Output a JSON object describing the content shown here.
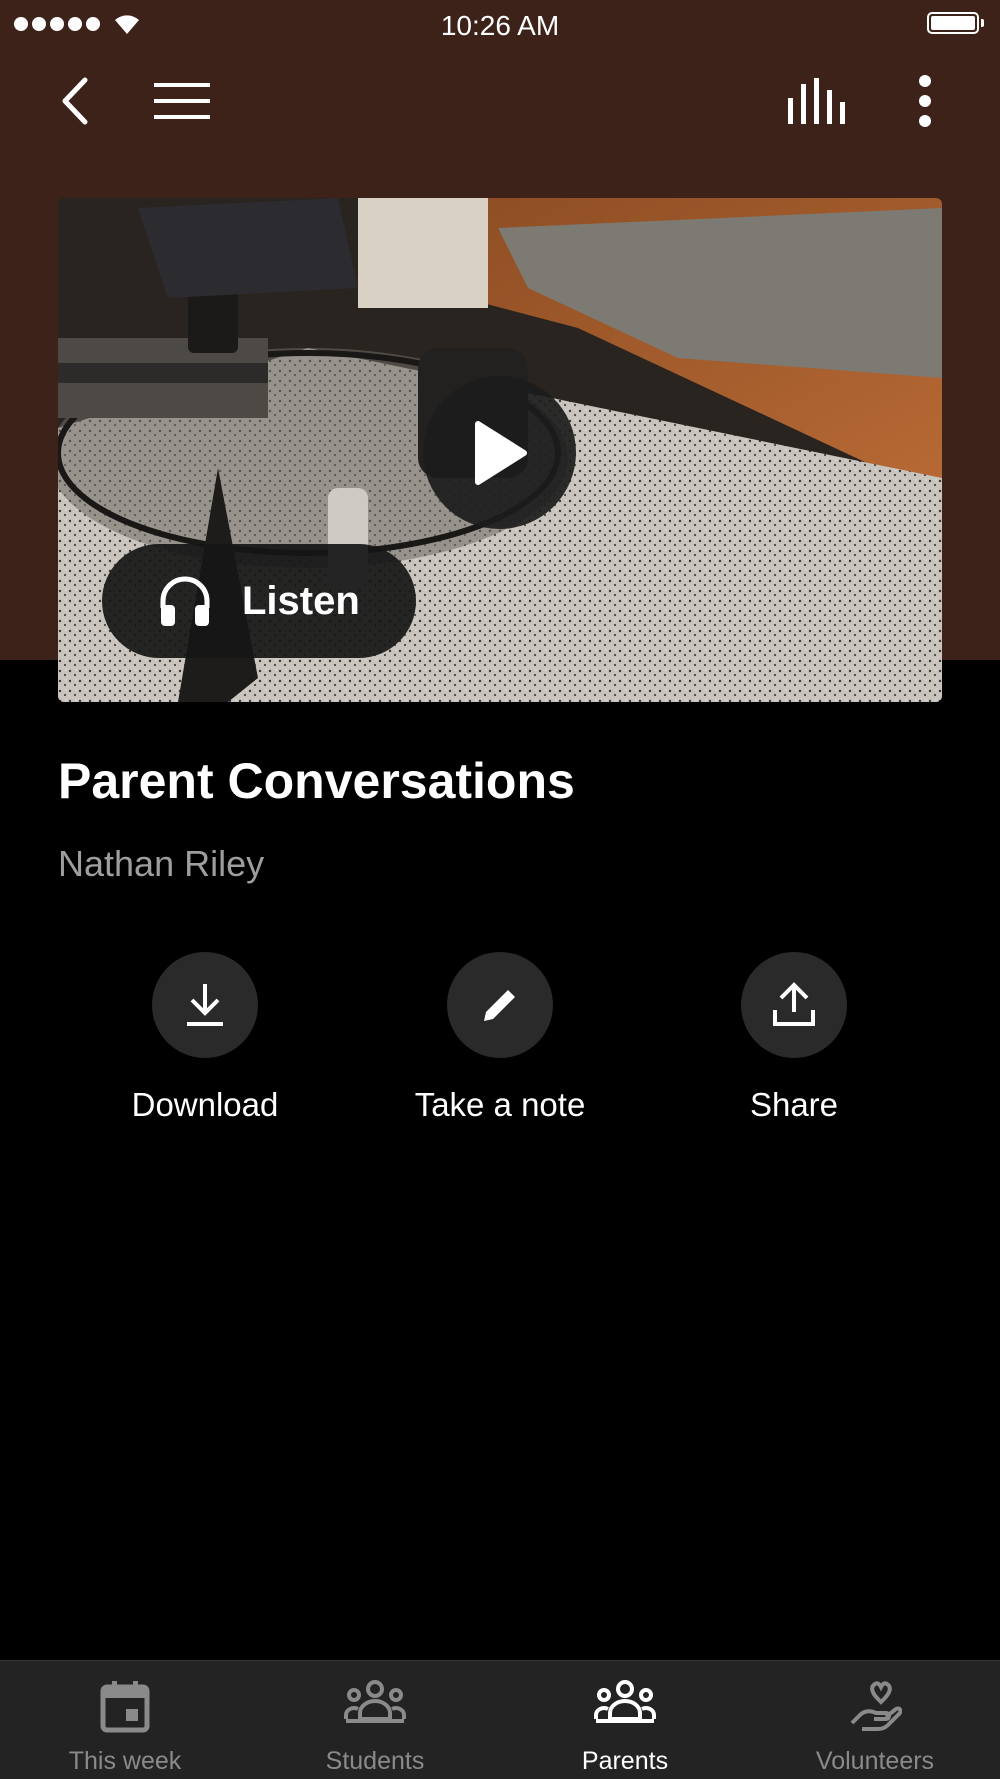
{
  "status_bar": {
    "time": "10:26 AM"
  },
  "nav": {
    "back_icon": "chevron-left-icon",
    "menu_icon": "hamburger-menu-icon",
    "bars_icon": "audio-bars-icon",
    "more_icon": "vertical-ellipsis-icon"
  },
  "hero": {
    "play_icon": "play-icon",
    "listen_label": "Listen",
    "listen_icon": "headphones-icon"
  },
  "content": {
    "title": "Parent Conversations",
    "author": "Nathan Riley"
  },
  "actions": [
    {
      "label": "Download",
      "icon": "download-icon"
    },
    {
      "label": "Take a note",
      "icon": "pencil-icon"
    },
    {
      "label": "Share",
      "icon": "share-icon"
    }
  ],
  "tabs": [
    {
      "label": "This week",
      "icon": "calendar-icon",
      "active": false
    },
    {
      "label": "Students",
      "icon": "group-icon",
      "active": false
    },
    {
      "label": "Parents",
      "icon": "group-icon",
      "active": true
    },
    {
      "label": "Volunteers",
      "icon": "hand-heart-icon",
      "active": false
    }
  ],
  "colors": {
    "header_bg": "#3d2219",
    "background": "#000000",
    "tab_bar_bg": "#232323",
    "inactive_tab": "#8a8a8a",
    "active_tab": "#ffffff"
  }
}
